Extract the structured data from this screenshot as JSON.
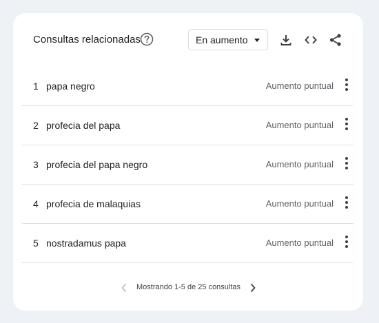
{
  "widget": {
    "title": "Consultas relacionadas",
    "help_icon": "help-circle-icon",
    "filter": {
      "selected": "En aumento"
    },
    "tools": [
      {
        "name": "download-icon"
      },
      {
        "name": "embed-code-icon"
      },
      {
        "name": "share-icon"
      }
    ]
  },
  "rows": [
    {
      "rank": "1",
      "term": "papa negro",
      "value": "Aumento puntual"
    },
    {
      "rank": "2",
      "term": "profecia del papa",
      "value": "Aumento puntual"
    },
    {
      "rank": "3",
      "term": "profecia del papa negro",
      "value": "Aumento puntual"
    },
    {
      "rank": "4",
      "term": "profecia de malaquias",
      "value": "Aumento puntual"
    },
    {
      "rank": "5",
      "term": "nostradamus papa",
      "value": "Aumento puntual"
    }
  ],
  "pagination": {
    "text": "Mostrando 1-5 de 25 consultas"
  },
  "colors": {
    "background": "#eef1f6",
    "card": "#ffffff",
    "text_primary": "#202124",
    "text_secondary": "#5f6368",
    "divider": "#e0e0e0",
    "disabled": "#bdc1c6"
  }
}
